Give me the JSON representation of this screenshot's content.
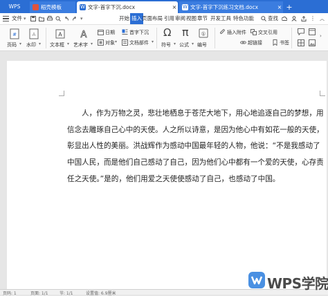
{
  "tabs": {
    "wps": "WPS",
    "daoke": "稻壳模板",
    "doc1": "文字-首字下沉.docx",
    "doc2": "文字-首字下沉练习文档.docx"
  },
  "menu": {
    "file": "文件",
    "start": "开始",
    "insert": "插入",
    "layout": "页面布局",
    "reference": "引用",
    "review": "审阅",
    "view": "视图",
    "chapter": "章节",
    "devtools": "开发工具",
    "features": "特色功能",
    "search": "查找"
  },
  "ribbon": {
    "page": "页码",
    "watermark": "水印",
    "textbox": "文本框",
    "wordart": "艺术字",
    "date": "日期",
    "object": "对象",
    "dropcap": "首字下沉",
    "docpart": "文档部件",
    "symbol": "符号",
    "formula": "公式",
    "numbering": "编号",
    "attachment": "插入附件",
    "crossref": "交叉引用",
    "hyperlink": "超链接",
    "bookmark": "书签"
  },
  "document": {
    "lines": [
      "人，作为万物之灵，悲壮地栖息于苍茫大地下，用心地追逐自己的梦想，用",
      "信念去雕琢自己心中的天使。人之所以诗意，是因为他心中有如花一般的天使，",
      "彰显出人性的美丽。洪战辉作为感动中国最年轻的人物，他说：“不是我感动了",
      "中国人民，而是他们自己感动了自己，因为他们心中都有一个爱的天使，心存责",
      "任之天使。”是的，他们用爱之天使使感动了自己，也感动了中国。"
    ]
  },
  "status": {
    "page": "页码: 1",
    "pages": "页面: 1/1",
    "section": "节: 1/1",
    "setting": "设置值: 6.9厘米"
  },
  "watermark_text": "WPS学院",
  "colors": {
    "accent": "#2b6ed4",
    "logo": "#4a90e2"
  }
}
